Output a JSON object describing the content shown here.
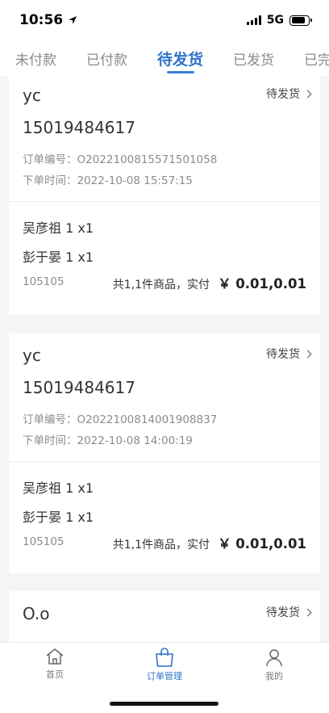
{
  "status_bar": {
    "time": "10:56",
    "network": "5G"
  },
  "tabs": [
    {
      "label": "未付款",
      "active": false
    },
    {
      "label": "已付款",
      "active": false
    },
    {
      "label": "待发货",
      "active": true
    },
    {
      "label": "已发货",
      "active": false
    },
    {
      "label": "已完成",
      "active": false
    }
  ],
  "orders": [
    {
      "buyer": "yc",
      "status": "待发货",
      "phone": "15019484617",
      "order_no_label": "订单编号：",
      "order_no": "O2022100815571501058",
      "time_label": "下单时间：",
      "time": "2022-10-08 15:57:15",
      "items": [
        "吴彦祖 1 x1",
        "彭于晏 1 x1"
      ],
      "sku": "105105",
      "summary": "共1,1件商品，实付",
      "price": "￥ 0.01,0.01"
    },
    {
      "buyer": "yc",
      "status": "待发货",
      "phone": "15019484617",
      "order_no_label": "订单编号：",
      "order_no": "O2022100814001908837",
      "time_label": "下单时间：",
      "time": "2022-10-08 14:00:19",
      "items": [
        "吴彦祖 1 x1",
        "彭于晏 1 x1"
      ],
      "sku": "105105",
      "summary": "共1,1件商品，实付",
      "price": "￥ 0.01,0.01"
    },
    {
      "buyer": "O.o",
      "status": "待发货"
    }
  ],
  "bottom_nav": [
    {
      "label": "首页",
      "icon": "home-icon",
      "active": false
    },
    {
      "label": "订单管理",
      "icon": "shopping-bag-icon",
      "active": true
    },
    {
      "label": "我的",
      "icon": "user-icon",
      "active": false
    }
  ],
  "colors": {
    "accent": "#2f73c9",
    "background": "#f4f5f7",
    "muted": "#8c8c8c"
  }
}
